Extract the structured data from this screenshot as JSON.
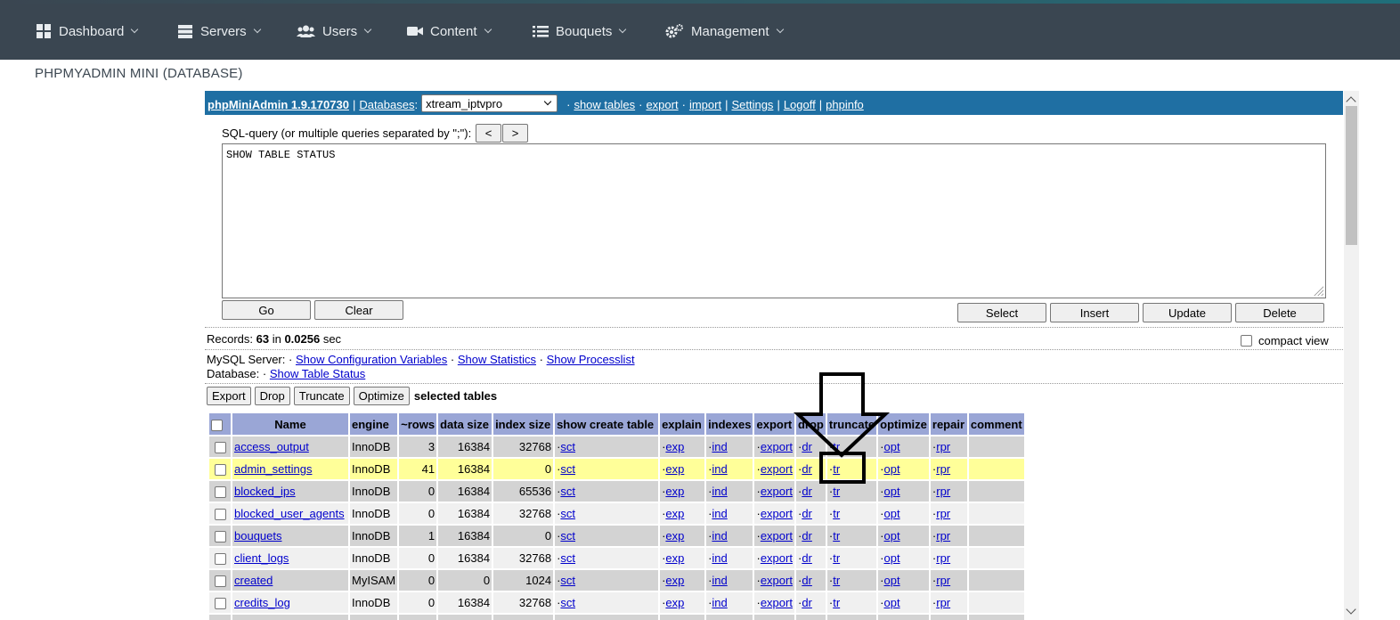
{
  "nav": {
    "items": [
      {
        "label": "Dashboard",
        "icon": "grid-icon"
      },
      {
        "label": "Servers",
        "icon": "server-icon"
      },
      {
        "label": "Users",
        "icon": "users-icon"
      },
      {
        "label": "Content",
        "icon": "video-camera-icon"
      },
      {
        "label": "Bouquets",
        "icon": "list-icon"
      },
      {
        "label": "Management",
        "icon": "gears-icon"
      }
    ]
  },
  "page": {
    "heading": "PHPMYADMIN MINI (DATABASE)"
  },
  "pma": {
    "brand": "phpMiniAdmin 1.9.170730",
    "databases_label": "Databases",
    "db_selected": "xtream_iptvpro",
    "links": {
      "show_tables": "show tables",
      "export": "export",
      "import": "import",
      "settings": "Settings",
      "logoff": "Logoff",
      "phpinfo": "phpinfo"
    },
    "sql_label": "SQL-query (or multiple queries separated by \";\"):",
    "hist_prev": "<",
    "hist_next": ">",
    "sql_value": "SHOW TABLE STATUS",
    "buttons": {
      "go": "Go",
      "clear": "Clear",
      "select": "Select",
      "insert": "Insert",
      "update": "Update",
      "delete": "Delete"
    },
    "records": {
      "prefix": "Records: ",
      "count": "63",
      "mid": " in ",
      "time": "0.0256",
      "suffix": " sec"
    },
    "compact_view": "compact view",
    "mysql_server_label": "MySQL Server:",
    "mysql_links": {
      "config": "Show Configuration Variables",
      "stats": "Show Statistics",
      "processlist": "Show Processlist"
    },
    "database_label": "Database:",
    "table_status_link": "Show Table Status",
    "bulk": {
      "export": "Export",
      "drop": "Drop",
      "truncate": "Truncate",
      "optimize": "Optimize",
      "label": "selected tables"
    }
  },
  "table": {
    "headers": [
      "Name",
      "engine",
      "~rows",
      "data size",
      "index size",
      "show create table",
      "explain",
      "indexes",
      "export",
      "drop",
      "truncate",
      "optimize",
      "repair",
      "comment"
    ],
    "link_labels": {
      "sct": "sct",
      "exp": "exp",
      "ind": "ind",
      "export": "export",
      "dr": "dr",
      "tr": "tr",
      "opt": "opt",
      "rpr": "rpr"
    },
    "rows": [
      {
        "name": "access_output",
        "engine": "InnoDB",
        "rows": "3",
        "data_size": "16384",
        "index_size": "32768"
      },
      {
        "name": "admin_settings",
        "engine": "InnoDB",
        "rows": "41",
        "data_size": "16384",
        "index_size": "0"
      },
      {
        "name": "blocked_ips",
        "engine": "InnoDB",
        "rows": "0",
        "data_size": "16384",
        "index_size": "65536"
      },
      {
        "name": "blocked_user_agents",
        "engine": "InnoDB",
        "rows": "0",
        "data_size": "16384",
        "index_size": "32768"
      },
      {
        "name": "bouquets",
        "engine": "InnoDB",
        "rows": "1",
        "data_size": "16384",
        "index_size": "0"
      },
      {
        "name": "client_logs",
        "engine": "InnoDB",
        "rows": "0",
        "data_size": "16384",
        "index_size": "32768"
      },
      {
        "name": "created",
        "engine": "MyISAM",
        "rows": "0",
        "data_size": "0",
        "index_size": "1024"
      },
      {
        "name": "credits_log",
        "engine": "InnoDB",
        "rows": "0",
        "data_size": "16384",
        "index_size": "32768"
      }
    ]
  },
  "colors": {
    "nav_bg": "#3a4651",
    "pma_bar": "#1f6fa3",
    "header_bg": "#9aa6d6",
    "highlight_row": "#ffff99",
    "link": "#0000cc"
  }
}
